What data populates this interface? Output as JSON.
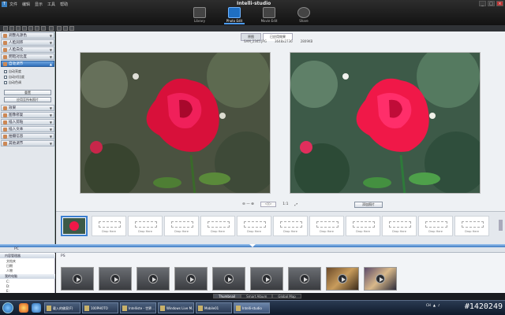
{
  "app": {
    "icon_letter": "T",
    "title": "Intelli-studio",
    "menu": [
      "文件",
      "编辑",
      "显示",
      "工具",
      "帮助"
    ],
    "window_controls": [
      "_",
      "□",
      "×"
    ]
  },
  "modes": [
    {
      "label": "Library",
      "icon": "library-icon",
      "active": false
    },
    {
      "label": "Photo Edit",
      "icon": "photo-edit-icon",
      "active": true
    },
    {
      "label": "Movie Edit",
      "icon": "movie-edit-icon",
      "active": false
    },
    {
      "label": "Share",
      "icon": "share-globe-icon",
      "active": false
    }
  ],
  "left_panel": {
    "sections": [
      {
        "label": "调整光源色",
        "icon": "light-icon"
      },
      {
        "label": "人脸润饰",
        "icon": "face-icon"
      },
      {
        "label": "人脸白化",
        "icon": "face-white-icon"
      },
      {
        "label": "明暗对比度",
        "icon": "contrast-icon"
      },
      {
        "label": "自动调节",
        "icon": "auto-adjust-icon",
        "active": true
      }
    ],
    "auto_options": [
      "自动亮度",
      "自动对比度",
      "自动色调"
    ],
    "buttons": [
      "重置",
      "应用至所有照片"
    ],
    "sections_lower": [
      {
        "label": "效果",
        "icon": "effect-icon"
      },
      {
        "label": "图像修复",
        "icon": "repair-icon"
      },
      {
        "label": "插入剪贴",
        "icon": "clip-icon"
      },
      {
        "label": "插入文本",
        "icon": "text-icon"
      },
      {
        "label": "拍摄信息",
        "icon": "info-icon"
      },
      {
        "label": "其他调节",
        "icon": "other-icon"
      }
    ]
  },
  "compare": {
    "tabs": [
      {
        "label": "原图",
        "active": false
      },
      {
        "label": "已应用效果",
        "active": true
      }
    ],
    "meta": [
      "SAM_2345.JPG",
      "3648x2736",
      "2809KB"
    ],
    "zoom_controls": [
      "⊖ — ⊕",
      "◁ ▷",
      "1:1",
      "⤢"
    ],
    "apply_button": "添加照片"
  },
  "filmstrip": {
    "drop_label": "Drop Here",
    "slots": 13
  },
  "browser": {
    "header": "PC",
    "folder": "PS",
    "tree": {
      "section_1": "内容管理器",
      "items_1": [
        "文档夹",
        "日期",
        "人物"
      ],
      "section_2": "我的电脑",
      "items_2": [
        "C:",
        "D:",
        "E:"
      ]
    },
    "view_tabs": [
      {
        "label": "Thumbnail",
        "active": true
      },
      {
        "label": "Smart Album",
        "active": false
      },
      {
        "label": "Global Map",
        "active": false
      }
    ]
  },
  "taskbar": {
    "tasks": [
      {
        "label": "载入的佛家(F)",
        "active": false
      },
      {
        "label": "100PHOTO",
        "active": false
      },
      {
        "label": "Intelliste - 世界...",
        "active": false
      },
      {
        "label": "Windows Live M...",
        "active": false
      },
      {
        "label": "Mobile01",
        "active": false
      },
      {
        "label": "Intelli-studio",
        "active": true
      }
    ],
    "tray_icons": [
      "CH",
      "▲",
      "♪"
    ],
    "watermark": "#1420249"
  }
}
